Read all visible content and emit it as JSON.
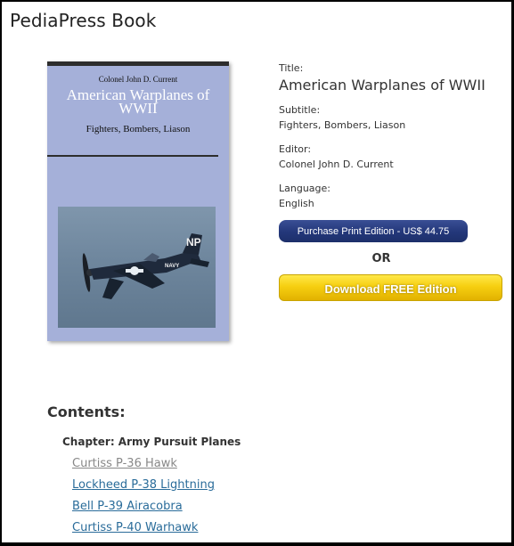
{
  "page": {
    "header_title": "PediaPress Book"
  },
  "cover": {
    "author": "Colonel John D. Current",
    "title": "American Warplanes of WWII",
    "subtitle": "Fighters, Bombers, Liason",
    "photo_marks": [
      "NP",
      "NAVY"
    ]
  },
  "info": {
    "title_label": "Title:",
    "title_value": "American Warplanes of WWII",
    "subtitle_label": "Subtitle:",
    "subtitle_value": "Fighters, Bombers, Liason",
    "editor_label": "Editor:",
    "editor_value": "Colonel John D. Current",
    "language_label": "Language:",
    "language_value": "English"
  },
  "actions": {
    "purchase_label": "Purchase Print Edition - US$ 44.75",
    "or_label": "OR",
    "download_label": "Download FREE Edition",
    "purchase_color": "#23377a",
    "download_color": "#f6cf10"
  },
  "contents": {
    "heading": "Contents:",
    "chapter": "Chapter: Army Pursuit Planes",
    "articles": [
      {
        "label": "Curtiss P-36 Hawk",
        "visited": true
      },
      {
        "label": "Lockheed P-38 Lightning",
        "visited": false
      },
      {
        "label": "Bell P-39 Airacobra",
        "visited": false
      },
      {
        "label": "Curtiss P-40 Warhawk",
        "visited": false
      }
    ]
  }
}
